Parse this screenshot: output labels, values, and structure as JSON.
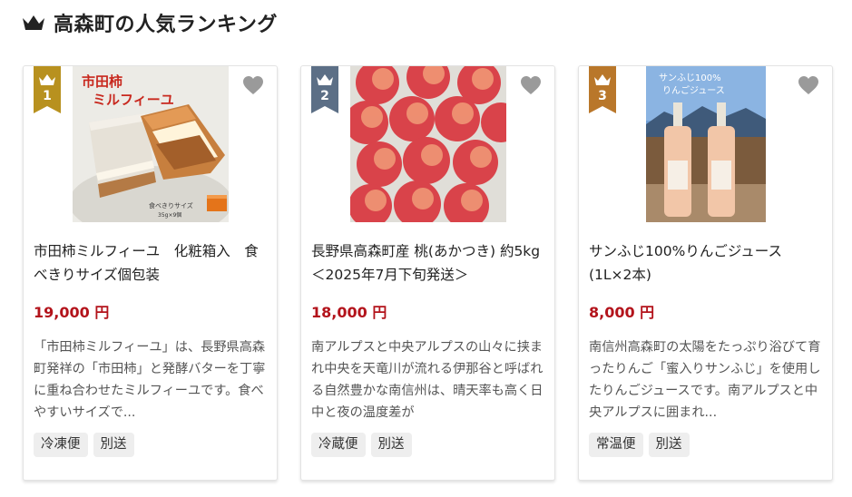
{
  "section": {
    "title": "高森町の人気ランキング",
    "icon": "crown-icon"
  },
  "colors": {
    "gold": "#b8911f",
    "silver": "#5c6f86",
    "bronze": "#b9772a",
    "price": "#b3131b",
    "tag_bg": "#eeeeee"
  },
  "products": [
    {
      "rank": "1",
      "rank_color": "gold",
      "image_caption": "市田柿\nミルフィーユ",
      "image_note": "食べきりサイズ\n35g×9個",
      "title": "市田柿ミルフィーユ　化粧箱入　食べきりサイズ個包装",
      "price": "19,000 円",
      "description": "「市田柿ミルフィーユ」は、長野県高森町発祥の「市田柿」と発酵バターを丁寧に重ね合わせたミルフィーユです。食べやすいサイズで...",
      "tags": [
        "冷凍便",
        "別送"
      ]
    },
    {
      "rank": "2",
      "rank_color": "silver",
      "title": "長野県高森町産 桃(あかつき) 約5kg ＜2025年7月下旬発送＞",
      "price": "18,000 円",
      "description": "南アルプスと中央アルプスの山々に挟まれ中央を天竜川が流れる伊那谷と呼ばれる自然豊かな南信州は、晴天率も高く日中と夜の温度差が",
      "tags": [
        "冷蔵便",
        "別送"
      ]
    },
    {
      "rank": "3",
      "rank_color": "bronze",
      "image_caption": "サンふじ100%\nりんごジュース",
      "title": "サンふじ100%りんごジュース(1L×2本)",
      "price": "8,000 円",
      "description": "南信州高森町の太陽をたっぷり浴びて育ったりんご「蜜入りサンふじ」を使用したりんごジュースです。南アルプスと中央アルプスに囲まれ...",
      "tags": [
        "常温便",
        "別送"
      ]
    }
  ]
}
